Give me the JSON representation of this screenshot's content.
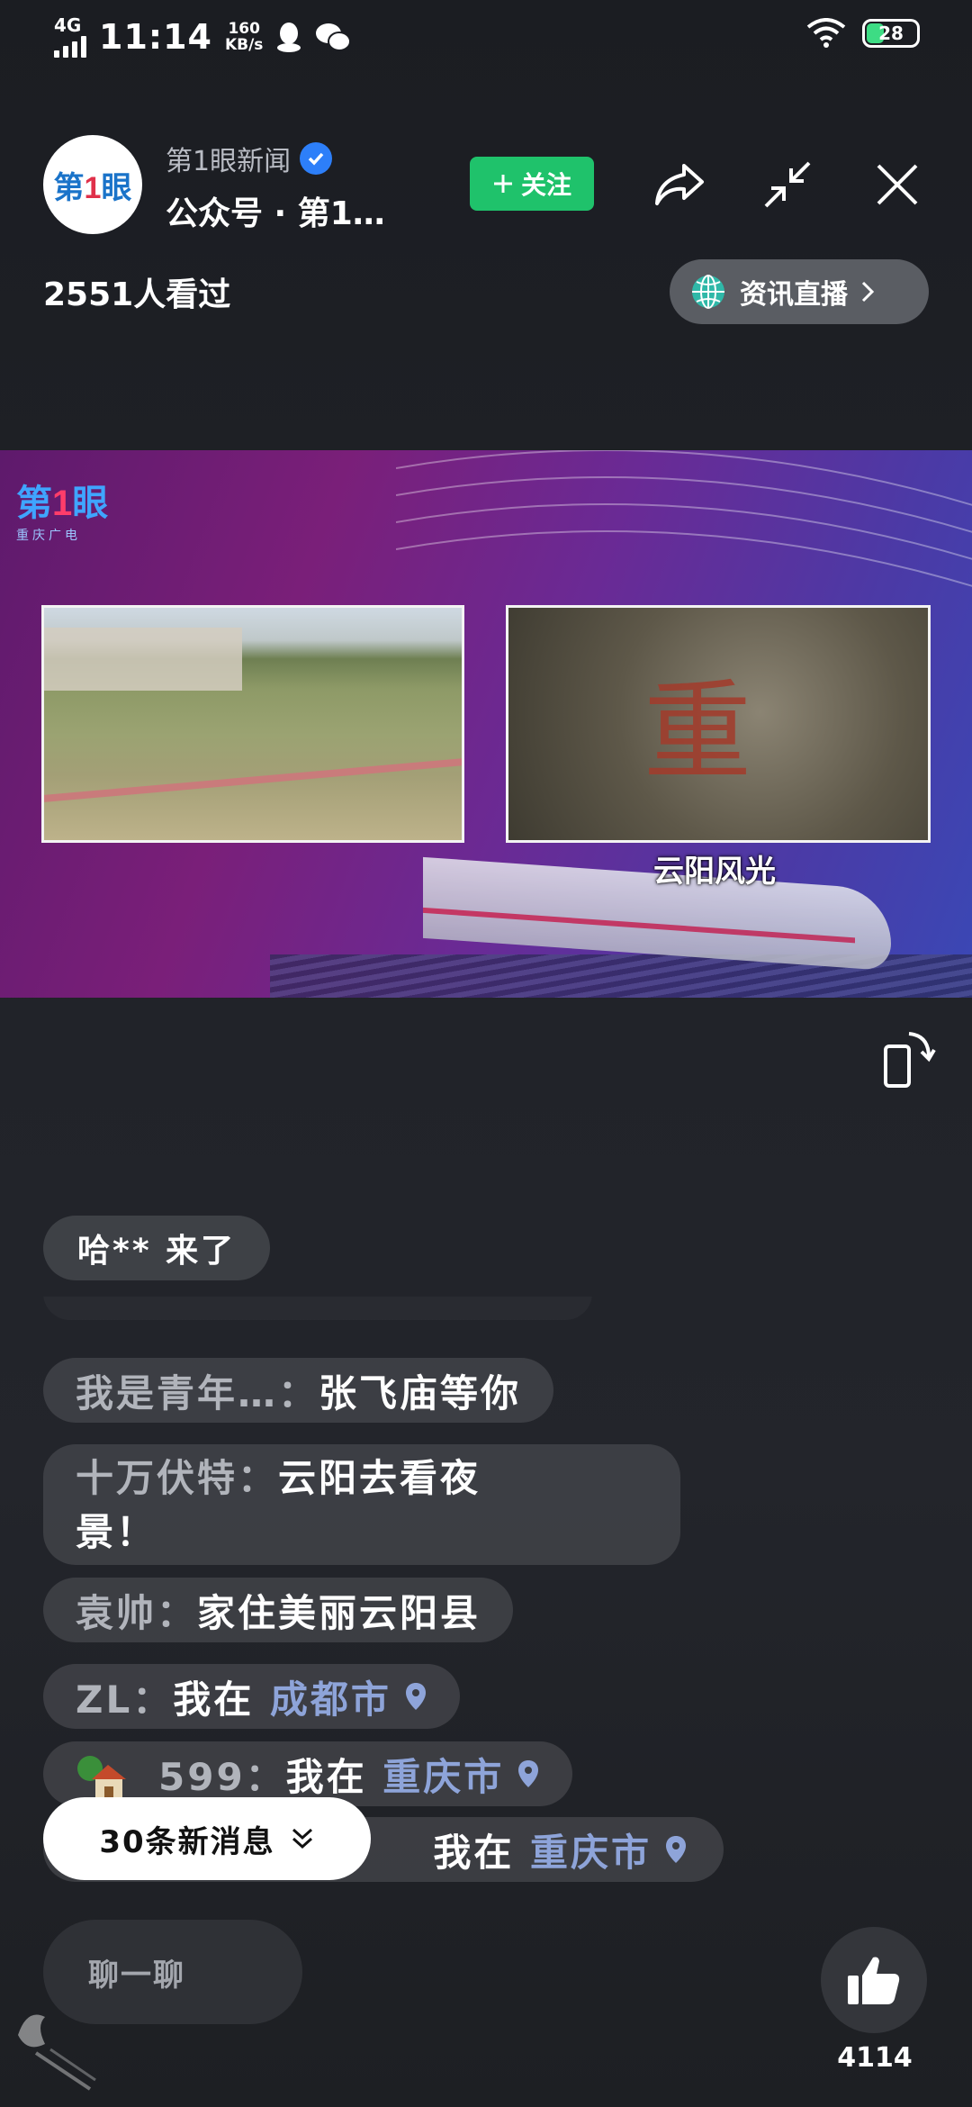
{
  "status_bar": {
    "network": "4G",
    "time": "11:14",
    "speed_value": "160",
    "speed_unit": "KB/s",
    "battery": "28"
  },
  "header": {
    "account_name": "第1眼新闻",
    "account_subtitle": "公众号 · 第1…",
    "follow_label": "关注",
    "viewers": "2551人看过",
    "live_pill_label": "资讯直播"
  },
  "video": {
    "caption": "云阳风光"
  },
  "chat": {
    "arrival": "哈** 来了",
    "messages": [
      {
        "nick": "我是青年…：",
        "text": "张飞庙等你",
        "loc": ""
      },
      {
        "nick": "十万伏特：",
        "text": "云阳去看夜",
        "text2": "景！",
        "loc": ""
      },
      {
        "nick": "袁帅：",
        "text": "家住美丽云阳县",
        "loc": ""
      },
      {
        "nick": "ZL：",
        "text": "我在 ",
        "loc": "成都市"
      },
      {
        "nick": "599：",
        "text": "我在 ",
        "loc": "重庆市"
      },
      {
        "nick": "",
        "text": "我在 ",
        "loc": "重庆市"
      }
    ]
  },
  "bottom": {
    "new_messages": "30条新消息",
    "input_placeholder": "聊一聊",
    "like_count": "4114"
  },
  "colors": {
    "follow_green": "#1fc26b",
    "verify_blue": "#2d7ff9",
    "location_blue": "#8ea4d9"
  }
}
